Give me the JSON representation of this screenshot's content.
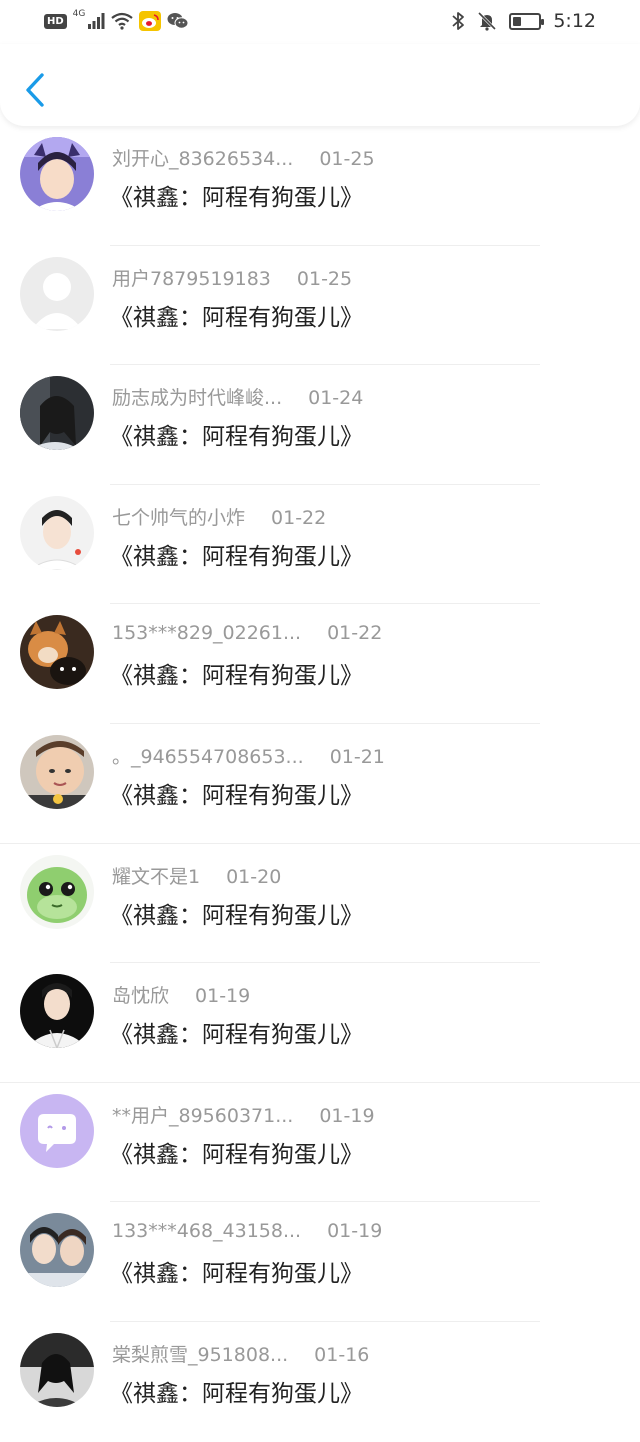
{
  "status_bar": {
    "hd": "HD",
    "network": "4G",
    "time": "5:12",
    "battery_level": 0.35
  },
  "nav": {
    "back_icon": "chevron-left-icon",
    "accent": "#1a9be8"
  },
  "items": [
    {
      "username": "刘开心_83626534...",
      "date": "01-25",
      "message": "《祺鑫：阿程有狗蛋儿》"
    },
    {
      "username": "用户7879519183",
      "date": "01-25",
      "message": "《祺鑫：阿程有狗蛋儿》"
    },
    {
      "username": "励志成为时代峰峻...",
      "date": "01-24",
      "message": "《祺鑫：阿程有狗蛋儿》"
    },
    {
      "username": "七个帅气的小炸",
      "date": "01-22",
      "message": "《祺鑫：阿程有狗蛋儿》"
    },
    {
      "username": "153***829_02261...",
      "date": "01-22",
      "message": "《祺鑫：阿程有狗蛋儿》"
    },
    {
      "username": "。_946554708653...",
      "date": "01-21",
      "message": "《祺鑫：阿程有狗蛋儿》"
    },
    {
      "username": "耀文不是1",
      "date": "01-20",
      "message": "《祺鑫：阿程有狗蛋儿》"
    },
    {
      "username": "岛忱欣",
      "date": "01-19",
      "message": "《祺鑫：阿程有狗蛋儿》"
    },
    {
      "username": "**用户_89560371...",
      "date": "01-19",
      "message": "《祺鑫：阿程有狗蛋儿》"
    },
    {
      "username": "133***468_43158...",
      "date": "01-19",
      "message": "《祺鑫：阿程有狗蛋儿》"
    },
    {
      "username": "棠梨煎雪_951808...",
      "date": "01-16",
      "message": "《祺鑫：阿程有狗蛋儿》"
    }
  ]
}
